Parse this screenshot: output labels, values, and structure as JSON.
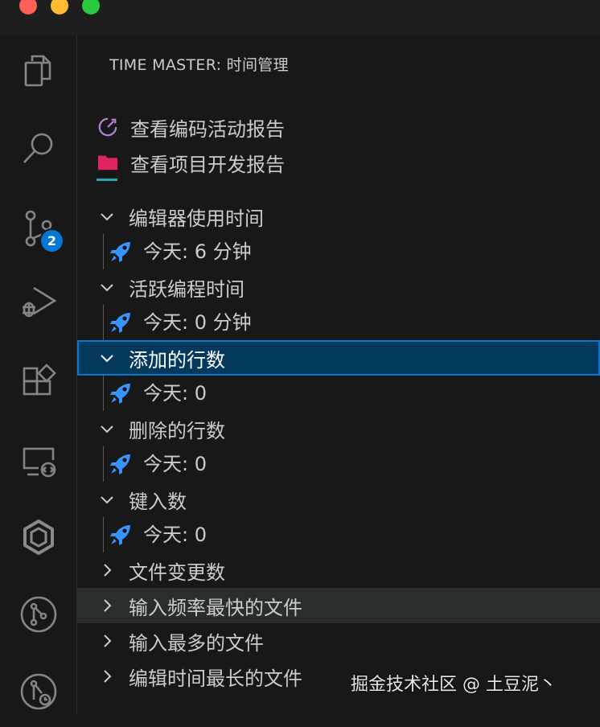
{
  "panel": {
    "title": "TIME MASTER: 时间管理"
  },
  "activity_bar": {
    "scm_badge": "2"
  },
  "reports": [
    {
      "label": "查看编码活动报告",
      "icon": "dashboard-icon",
      "color": "#b180d7"
    },
    {
      "label": "查看项目开发报告",
      "icon": "folder-icon",
      "color": "#e0245e"
    }
  ],
  "tree": [
    {
      "label": "编辑器使用时间",
      "expanded": true,
      "child": "今天: 6 分钟"
    },
    {
      "label": "活跃编程时间",
      "expanded": true,
      "child": "今天: 0 分钟"
    },
    {
      "label": "添加的行数",
      "expanded": true,
      "child": "今天: 0",
      "selected": true
    },
    {
      "label": "删除的行数",
      "expanded": true,
      "child": "今天: 0"
    },
    {
      "label": "键入数",
      "expanded": true,
      "child": "今天: 0"
    },
    {
      "label": "文件变更数",
      "expanded": false
    },
    {
      "label": "输入频率最快的文件",
      "expanded": false,
      "hovered": true
    },
    {
      "label": "输入最多的文件",
      "expanded": false
    },
    {
      "label": "编辑时间最长的文件",
      "expanded": false
    }
  ],
  "watermark": "掘金技术社区 @ 土豆泥丶",
  "colors": {
    "accent": "#0078d4",
    "rocket": "#3794ff",
    "selection": "#04395e"
  }
}
